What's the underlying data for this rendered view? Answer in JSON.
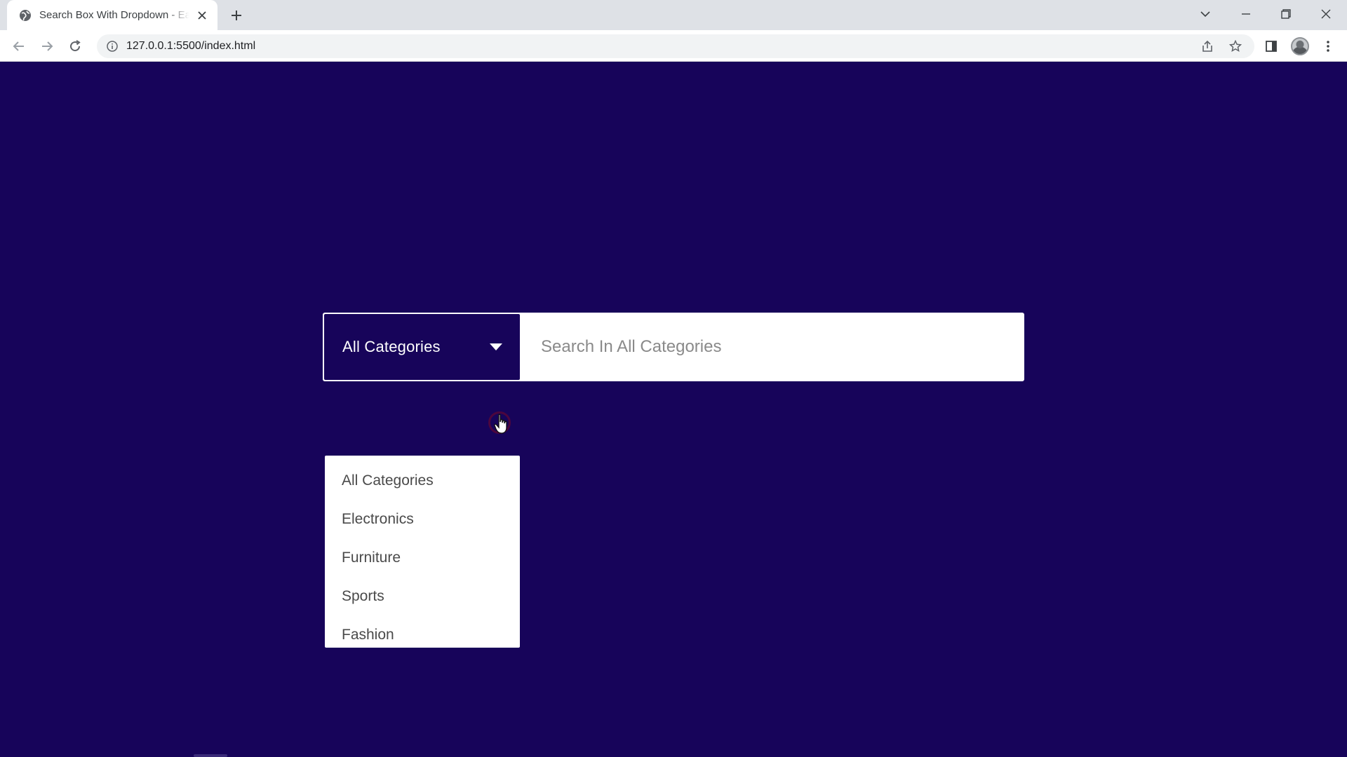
{
  "browser": {
    "tab_title": "Search Box With Dropdown - Easy Tutorials",
    "url": "127.0.0.1:5500/index.html"
  },
  "search": {
    "selected_category": "All Categories",
    "placeholder": "Search In All Categories"
  },
  "dropdown": {
    "items": [
      {
        "label": "All Categories"
      },
      {
        "label": "Electronics"
      },
      {
        "label": "Furniture"
      },
      {
        "label": "Sports"
      },
      {
        "label": "Fashion"
      }
    ]
  },
  "colors": {
    "page_background": "#17045a",
    "search_box": "#ffffff",
    "select_background": "#17045a"
  }
}
